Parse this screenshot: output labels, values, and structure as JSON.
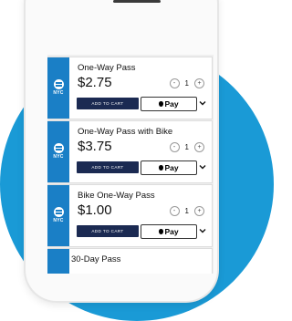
{
  "brand": {
    "logo_text": "NYC",
    "accent": "#1a9ad6",
    "stripe": "#1a7fc6"
  },
  "passes": [
    {
      "title": "One-Way Pass",
      "price": "$2.75",
      "quantity": "1",
      "add_label": "ADD TO CART",
      "pay_label": "Pay"
    },
    {
      "title": "One-Way Pass with Bike",
      "price": "$3.75",
      "quantity": "1",
      "add_label": "ADD TO CART",
      "pay_label": "Pay"
    },
    {
      "title": "Bike One-Way Pass",
      "price": "$1.00",
      "quantity": "1",
      "add_label": "ADD TO CART",
      "pay_label": "Pay"
    },
    {
      "title": "30-Day Pass"
    }
  ],
  "controls": {
    "minus": "-",
    "plus": "+"
  },
  "icons": [
    "nyc-ferry-logo-icon",
    "minus-icon",
    "plus-icon",
    "apple-logo-icon",
    "chevron-down-icon"
  ]
}
